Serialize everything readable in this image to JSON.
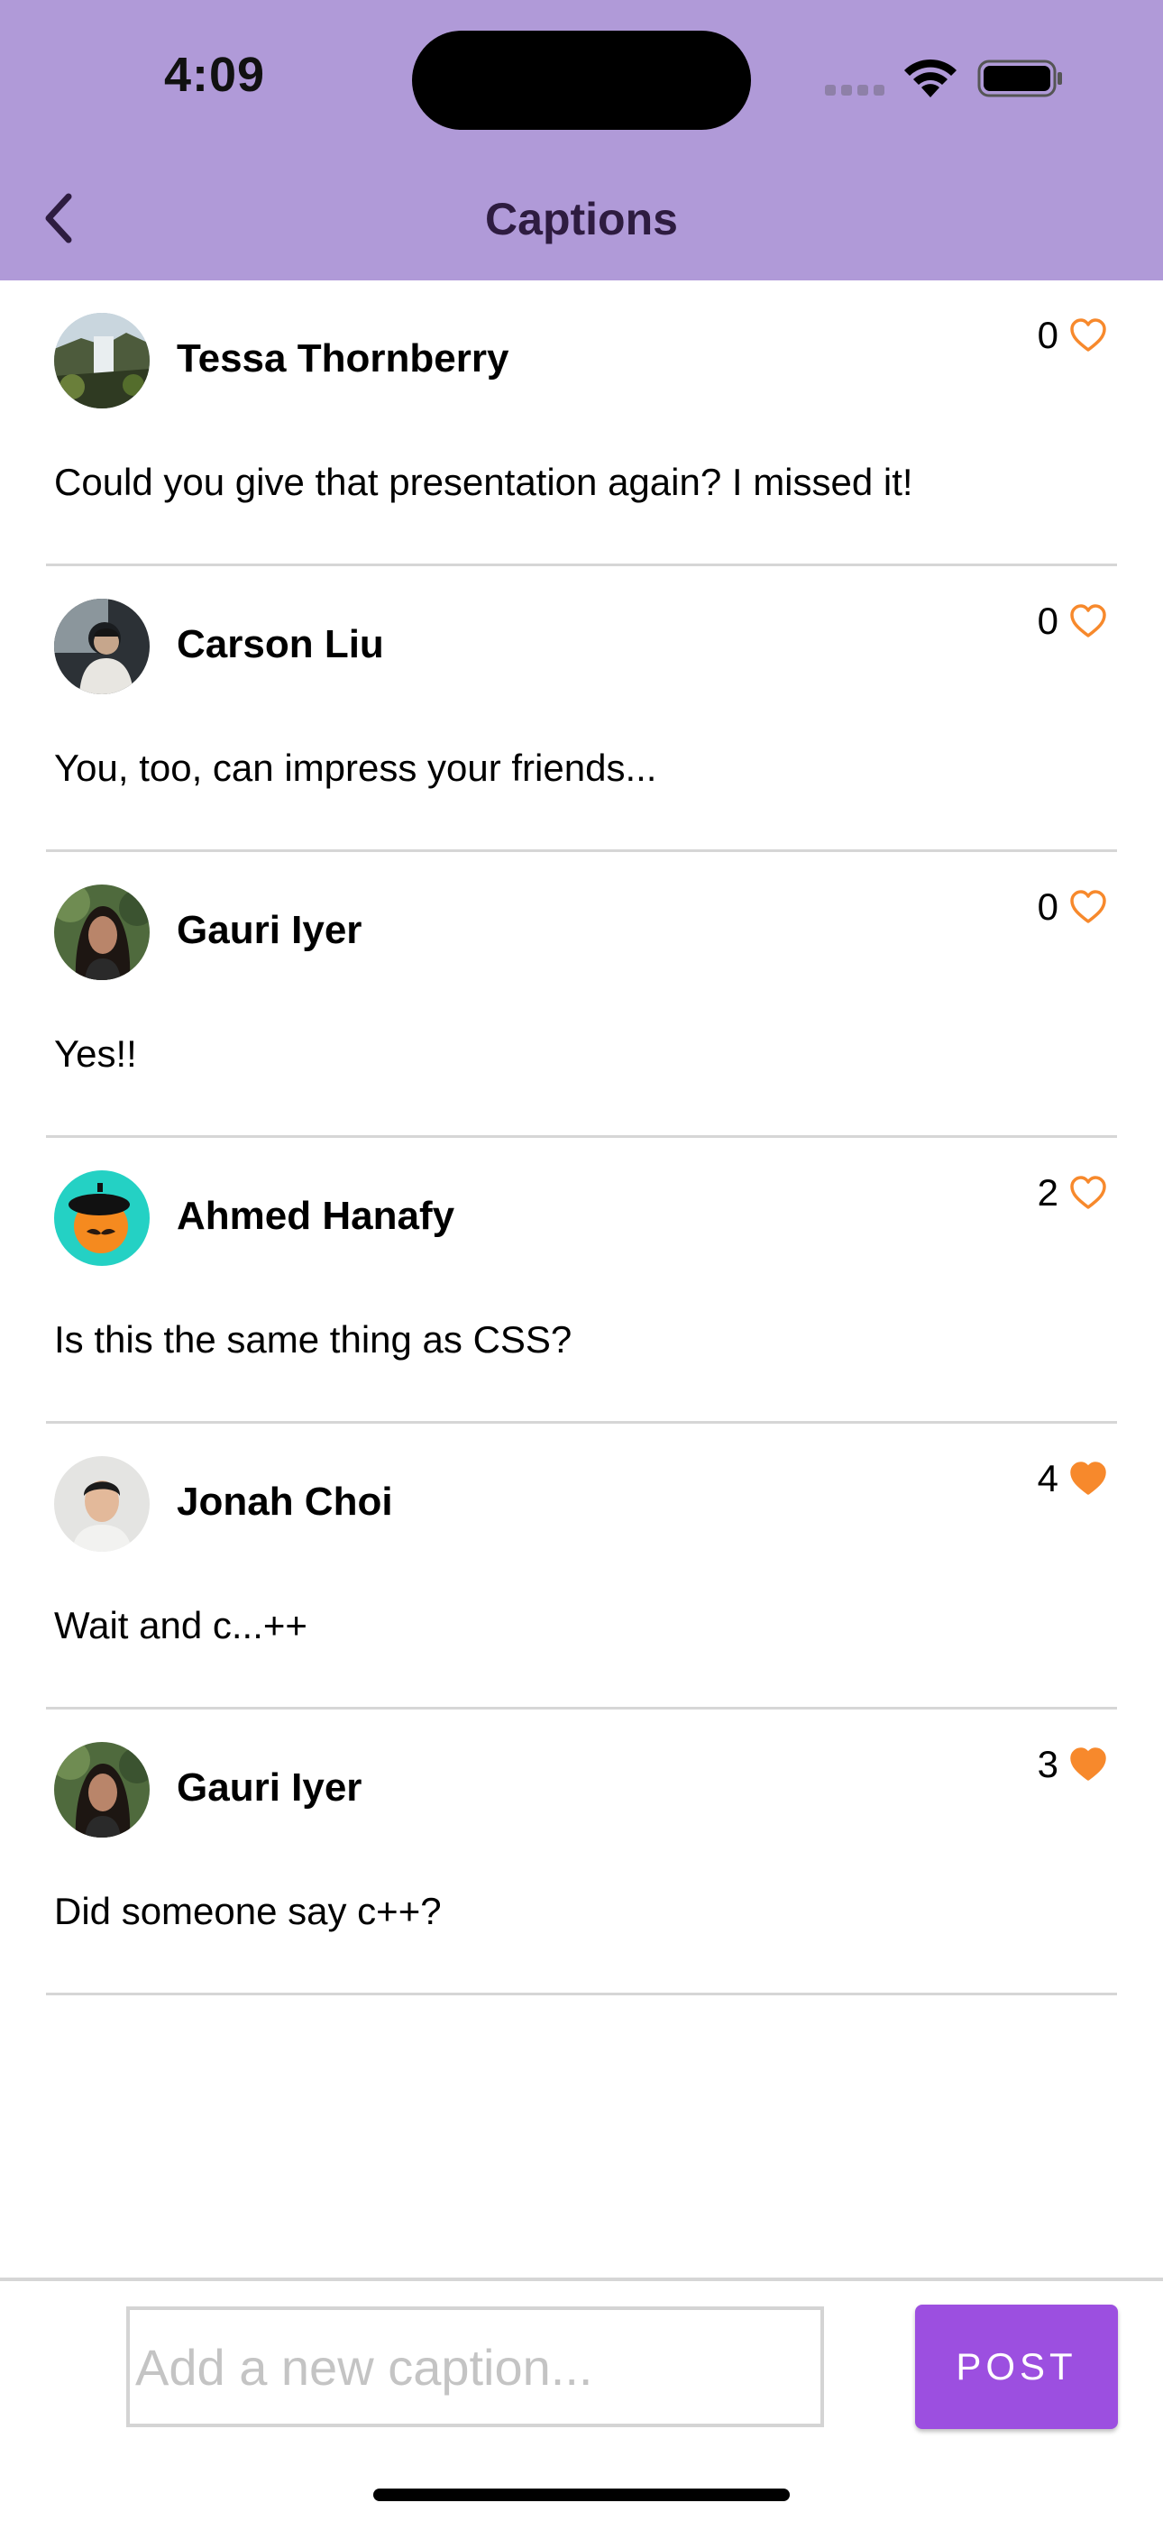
{
  "status_bar": {
    "time": "4:09"
  },
  "header": {
    "title": "Captions",
    "back_icon": "chevron-left-icon",
    "background": "#b09ad8"
  },
  "captions": [
    {
      "user": "Tessa Thornberry",
      "text": "Could you give that presentation again? I missed it!",
      "likes": "0",
      "liked": false,
      "avatar": "waterfall-landscape"
    },
    {
      "user": "Carson Liu",
      "text": "You, too, can impress your friends...",
      "likes": "0",
      "liked": false,
      "avatar": "person-in-car"
    },
    {
      "user": "Gauri Iyer",
      "text": "Yes!!",
      "likes": "0",
      "liked": false,
      "avatar": "woman-outdoors"
    },
    {
      "user": "Ahmed Hanafy",
      "text": "Is this the same thing as CSS?",
      "likes": "2",
      "liked": false,
      "avatar": "orange-character-beret"
    },
    {
      "user": "Jonah Choi",
      "text": "Wait and c...++",
      "likes": "4",
      "liked": true,
      "avatar": "man-portrait"
    },
    {
      "user": "Gauri Iyer",
      "text": "Did someone say c++?",
      "likes": "3",
      "liked": true,
      "avatar": "woman-outdoors"
    }
  ],
  "composer": {
    "placeholder": "Add a new caption...",
    "value": "",
    "post_label": "POST"
  },
  "colors": {
    "accent": "#9c4fe0",
    "heart": "#f7892c"
  }
}
